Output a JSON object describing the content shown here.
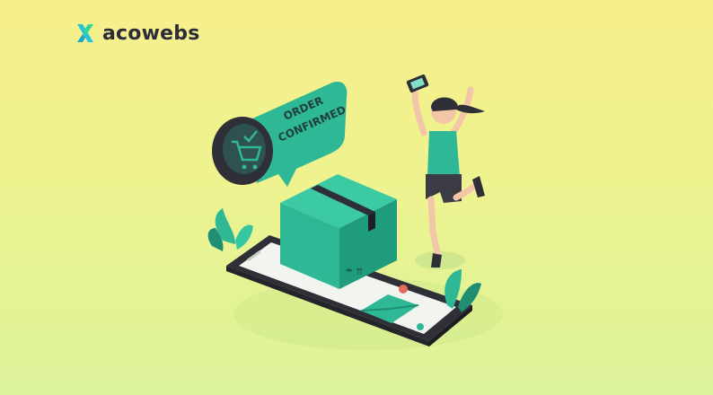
{
  "brand": {
    "name": "acowebs",
    "accent": "#2bd1b4",
    "dark": "#2c2c3a"
  },
  "illustration": {
    "bubble_line1": "ORDER",
    "bubble_line2": "CONFIRMED",
    "colors": {
      "teal": "#2fb896",
      "teal_dark": "#1f8e73",
      "phone_dark": "#2f2f37",
      "background_top": "#f6ef8c",
      "background_bottom": "#dcf39a"
    }
  }
}
